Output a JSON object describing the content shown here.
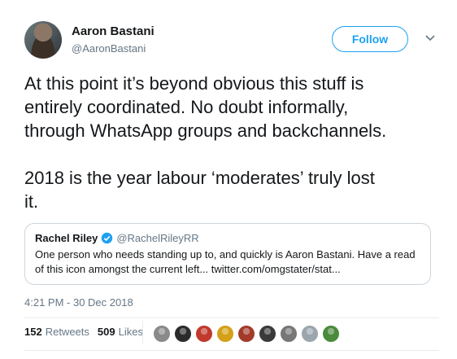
{
  "author": {
    "name": "Aaron Bastani",
    "handle": "@AaronBastani"
  },
  "follow_label": "Follow",
  "tweet_text": "At this point it’s beyond obvious this stuff is\nentirely coordinated. No doubt informally,\nthrough WhatsApp groups and backchannels.\n\n2018 is the year labour ‘moderates’ truly lost\nit.",
  "quoted_tweet": {
    "name": "Rachel Riley",
    "handle": "@RachelRileyRR",
    "text": "One person who needs standing up to, and quickly is Aaron Bastani. Have a read of this icon amongst the current left... twitter.com/omgstater/stat..."
  },
  "timestamp": "4:21 PM - 30 Dec 2018",
  "stats": {
    "retweets_count": "152",
    "retweets_label": "Retweets",
    "likes_count": "509",
    "likes_label": "Likes"
  },
  "likers": [
    {
      "icon": "liker-avatar-1",
      "color": "#8a8a8a"
    },
    {
      "icon": "liker-avatar-2",
      "color": "#2b2b2b"
    },
    {
      "icon": "liker-avatar-3",
      "color": "#c0392b"
    },
    {
      "icon": "liker-avatar-4",
      "color": "#d4a017"
    },
    {
      "icon": "liker-avatar-5",
      "color": "#a33b2a"
    },
    {
      "icon": "liker-avatar-6",
      "color": "#3a3a3a"
    },
    {
      "icon": "liker-avatar-7",
      "color": "#777777"
    },
    {
      "icon": "liker-avatar-8",
      "color": "#9aa5ad"
    },
    {
      "icon": "liker-avatar-9",
      "color": "#4a8a3c"
    }
  ],
  "colors": {
    "accent": "#1da1f2",
    "secondary_text": "#657786",
    "border": "#ccd6dd"
  }
}
